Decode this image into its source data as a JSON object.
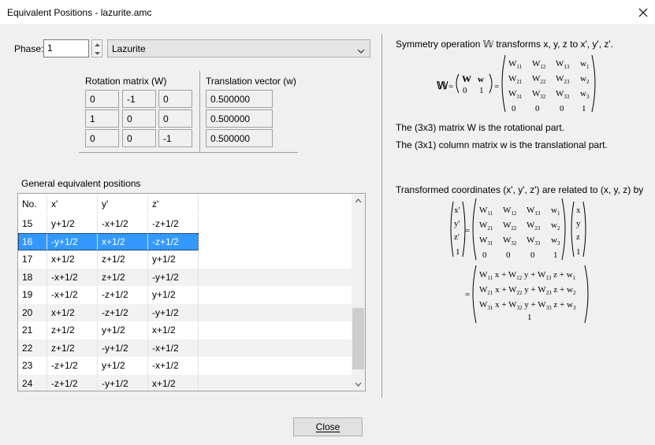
{
  "window": {
    "title": "Equivalent Positions - lazurite.amc"
  },
  "phase": {
    "label": "Phase:",
    "value": "1",
    "selected": "Lazurite"
  },
  "rotation": {
    "title": "Rotation matrix (W)",
    "rows": [
      [
        "0",
        "-1",
        "0"
      ],
      [
        "1",
        "0",
        "0"
      ],
      [
        "0",
        "0",
        "-1"
      ]
    ]
  },
  "translation": {
    "title": "Translation vector (w)",
    "values": [
      "0.500000",
      "0.500000",
      "0.500000"
    ]
  },
  "positions": {
    "title": "General equivalent positions",
    "headers": [
      "No.",
      "x'",
      "y'",
      "z'"
    ],
    "rows": [
      [
        "15",
        "y+1/2",
        "-x+1/2",
        "-z+1/2"
      ],
      [
        "16",
        "-y+1/2",
        "x+1/2",
        "-z+1/2"
      ],
      [
        "17",
        "x+1/2",
        "z+1/2",
        "y+1/2"
      ],
      [
        "18",
        "-x+1/2",
        "z+1/2",
        "-y+1/2"
      ],
      [
        "19",
        "-x+1/2",
        "-z+1/2",
        "y+1/2"
      ],
      [
        "20",
        "x+1/2",
        "-z+1/2",
        "-y+1/2"
      ],
      [
        "21",
        "z+1/2",
        "y+1/2",
        "x+1/2"
      ],
      [
        "22",
        "z+1/2",
        "-y+1/2",
        "-x+1/2"
      ],
      [
        "23",
        "-z+1/2",
        "y+1/2",
        "-x+1/2"
      ],
      [
        "24",
        "-z+1/2",
        "-y+1/2",
        "x+1/2"
      ]
    ],
    "selected_no": "16"
  },
  "info": {
    "line1": "Symmetry operation 𝕎 transforms x, y, z to x', y', z'.",
    "line2": "The (3x3) matrix W is the rotational part.",
    "line3": "The (3x1) column matrix w is the translational part.",
    "line4": "Transformed coordinates (x', y', z') are related to (x, y, z) by"
  },
  "buttons": {
    "close": "Close"
  },
  "colors": {
    "selection": "#3399ff",
    "window_bg": "#f0f0f0"
  }
}
